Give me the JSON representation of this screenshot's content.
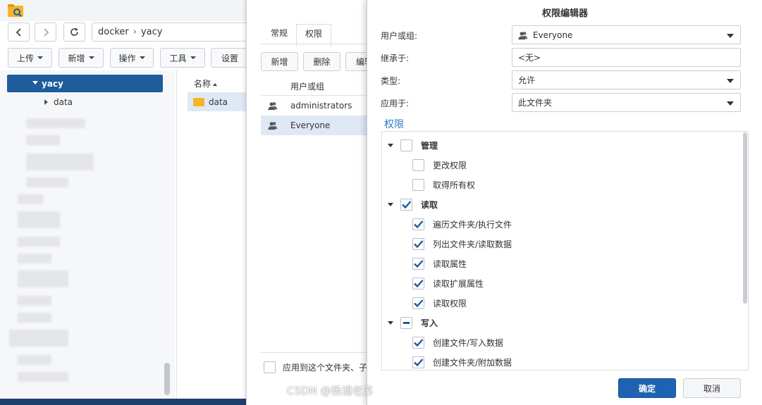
{
  "file_station": {
    "path": {
      "root": "docker",
      "current": "yacy"
    },
    "toolbar": [
      "上传",
      "新增",
      "操作",
      "工具",
      "设置"
    ],
    "tree": {
      "selected": "yacy",
      "child": "data"
    },
    "list": {
      "header": "名称",
      "rows": [
        "data"
      ]
    }
  },
  "properties": {
    "tabs": [
      "常规",
      "权限"
    ],
    "buttons": [
      "新增",
      "删除",
      "编辑"
    ],
    "grid_header": "用户或组",
    "rows": [
      "administrators",
      "Everyone"
    ],
    "apply_label": "应用到这个文件夹、子"
  },
  "editor": {
    "title": "权限编辑器",
    "fields": [
      {
        "label": "用户或组:",
        "value": "Everyone",
        "dropdown": true,
        "icon": "user-icon"
      },
      {
        "label": "继承于:",
        "value": "<无>",
        "dropdown": false
      },
      {
        "label": "类型:",
        "value": "允许",
        "dropdown": true
      },
      {
        "label": "应用于:",
        "value": "此文件夹",
        "dropdown": true
      }
    ],
    "perm_title": "权限",
    "perms": [
      {
        "label": "管理",
        "level": 0,
        "state": "unchecked",
        "expanded": true
      },
      {
        "label": "更改权限",
        "level": 1,
        "state": "unchecked"
      },
      {
        "label": "取得所有权",
        "level": 1,
        "state": "unchecked"
      },
      {
        "label": "读取",
        "level": 0,
        "state": "checked",
        "expanded": true
      },
      {
        "label": "遍历文件夹/执行文件",
        "level": 1,
        "state": "checked"
      },
      {
        "label": "列出文件夹/读取数据",
        "level": 1,
        "state": "checked"
      },
      {
        "label": "读取属性",
        "level": 1,
        "state": "checked"
      },
      {
        "label": "读取扩展属性",
        "level": 1,
        "state": "checked"
      },
      {
        "label": "读取权限",
        "level": 1,
        "state": "checked"
      },
      {
        "label": "写入",
        "level": 0,
        "state": "partial",
        "expanded": true
      },
      {
        "label": "创建文件/写入数据",
        "level": 1,
        "state": "checked"
      },
      {
        "label": "创建文件夹/附加数据",
        "level": 1,
        "state": "checked"
      }
    ],
    "ok_label": "确定",
    "cancel_label": "取消"
  },
  "watermark": "CSDN @杨浦老苏",
  "colors": {
    "accent": "#1e63b3",
    "selection": "#1f5c9c",
    "check": "#1f5c9c",
    "link": "#2d7ac1"
  }
}
